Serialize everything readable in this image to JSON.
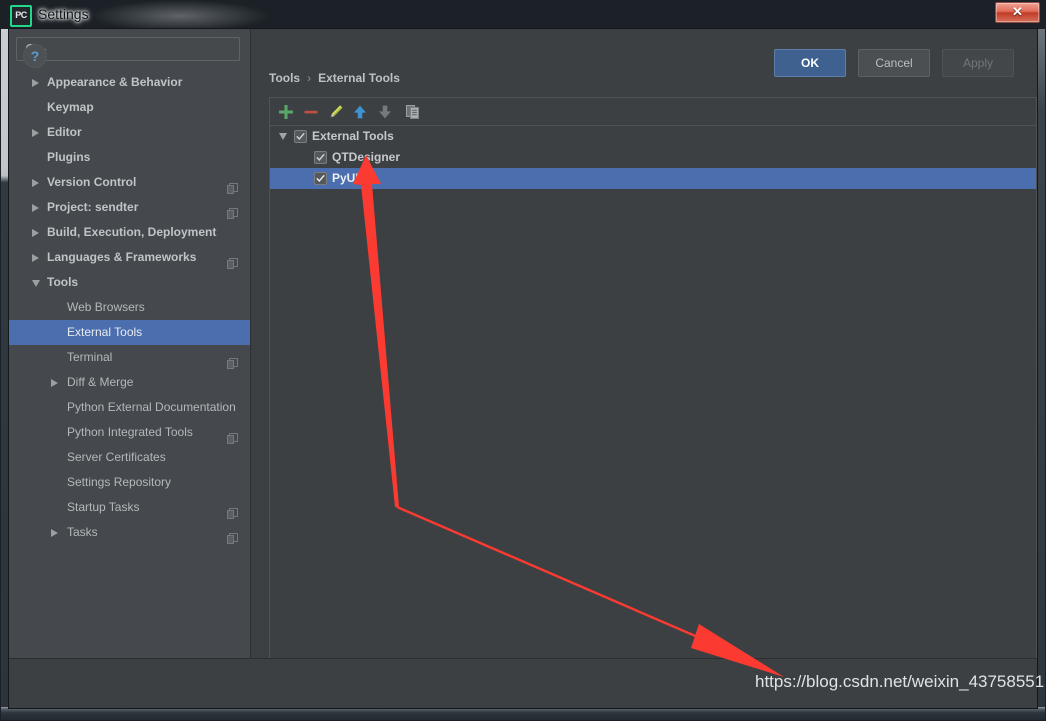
{
  "window": {
    "title": "Settings",
    "app_icon_text": "PC",
    "close_glyph": "✕"
  },
  "sidebar": {
    "search": {
      "value": "",
      "placeholder": ""
    },
    "items": [
      {
        "label": "Appearance & Behavior"
      },
      {
        "label": "Keymap"
      },
      {
        "label": "Editor"
      },
      {
        "label": "Plugins"
      },
      {
        "label": "Version Control"
      },
      {
        "label": "Project: sendter"
      },
      {
        "label": "Build, Execution, Deployment"
      },
      {
        "label": "Languages & Frameworks"
      },
      {
        "label": "Tools"
      },
      {
        "label": "Web Browsers"
      },
      {
        "label": "External Tools"
      },
      {
        "label": "Terminal"
      },
      {
        "label": "Diff & Merge"
      },
      {
        "label": "Python External Documentation"
      },
      {
        "label": "Python Integrated Tools"
      },
      {
        "label": "Server Certificates"
      },
      {
        "label": "Settings Repository"
      },
      {
        "label": "Startup Tasks"
      },
      {
        "label": "Tasks"
      }
    ],
    "selected": "External Tools"
  },
  "main": {
    "breadcrumb": {
      "root": "Tools",
      "separator": "›",
      "leaf": "External Tools"
    },
    "toolbar": {
      "add": "add-icon",
      "remove": "remove-icon",
      "edit": "edit-pencil-icon",
      "move_up": "arrow-up-icon",
      "move_down": "arrow-down-icon",
      "copy": "copy-icon"
    },
    "tree": [
      {
        "label": "External Tools",
        "checked": true,
        "expanded": true,
        "selected": false
      },
      {
        "label": "QTDesigner",
        "checked": true,
        "selected": false
      },
      {
        "label": "PyUIC",
        "checked": true,
        "selected": true
      }
    ]
  },
  "footer": {
    "help": "?",
    "ok": "OK",
    "cancel": "Cancel",
    "apply": "Apply"
  },
  "overlay": {
    "watermark": "https://blog.csdn.net/weixin_43758551",
    "annotation_color": "#fb3a32"
  }
}
